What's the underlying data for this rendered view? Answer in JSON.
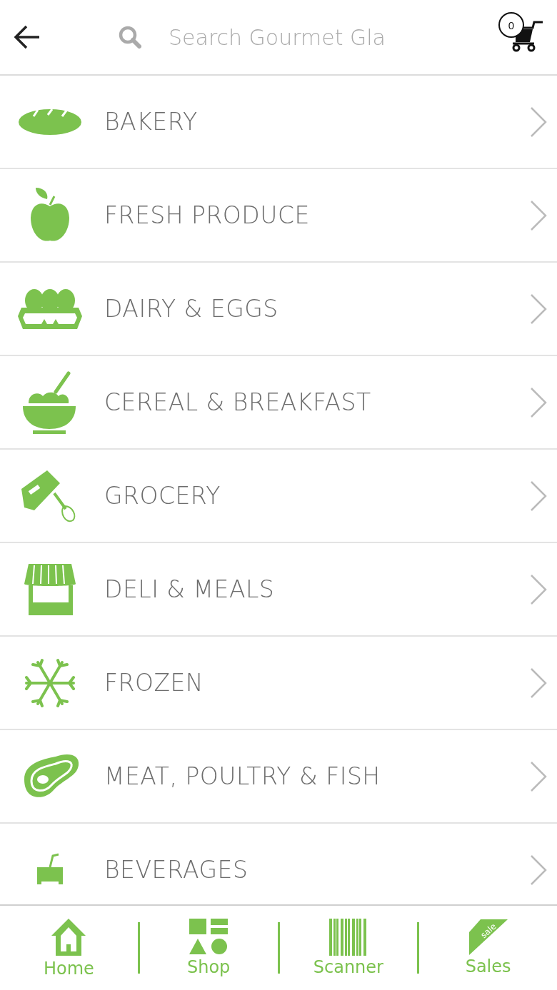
{
  "header": {
    "search": {
      "placeholder": "Search Gourmet Gla"
    },
    "cart": {
      "count": "0"
    }
  },
  "categories": [
    {
      "label": "BAKERY",
      "kind": "bread"
    },
    {
      "label": "FRESH PRODUCE",
      "kind": "apple"
    },
    {
      "label": "DAIRY & EGGS",
      "kind": "eggs"
    },
    {
      "label": "CEREAL & BREAKFAST",
      "kind": "bowl"
    },
    {
      "label": "GROCERY",
      "kind": "mixer"
    },
    {
      "label": "DELI & MEALS",
      "kind": "store"
    },
    {
      "label": "FROZEN",
      "kind": "snowflake"
    },
    {
      "label": "MEAT, POULTRY & FISH",
      "kind": "meat"
    },
    {
      "label": "BEVERAGES",
      "kind": "cup"
    }
  ],
  "nav": [
    {
      "label": "Home",
      "kind": "home"
    },
    {
      "label": "Shop",
      "kind": "shop"
    },
    {
      "label": "Scanner",
      "kind": "scanner"
    },
    {
      "label": "Sales",
      "kind": "sales",
      "tag": "sale"
    }
  ]
}
